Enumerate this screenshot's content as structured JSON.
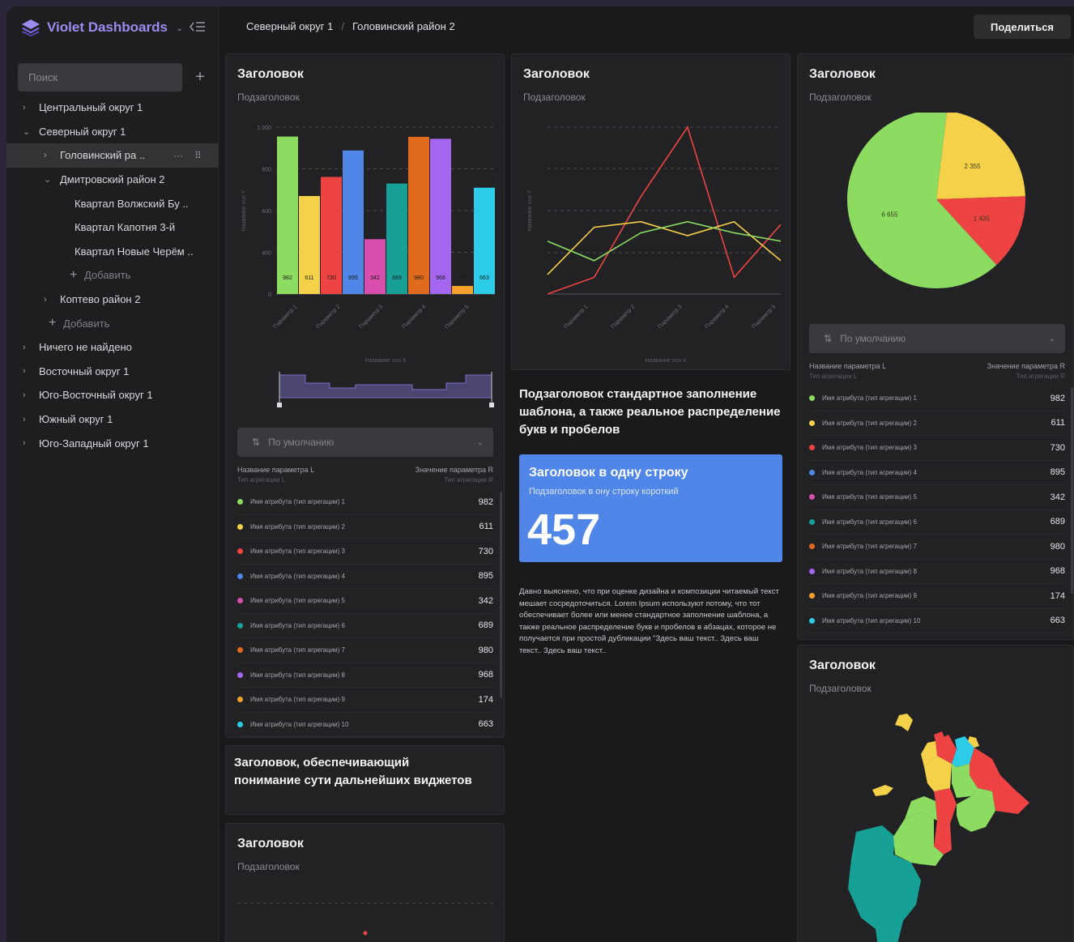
{
  "sidebar": {
    "app_name": "Violet Dashboards",
    "search_placeholder": "Поиск",
    "tree": [
      {
        "label": "Центральный округ 1",
        "level": 0,
        "arrow": "›"
      },
      {
        "label": "Северный округ 1",
        "level": 0,
        "arrow": "⌄"
      },
      {
        "label": "Головинский ра ..",
        "level": 1,
        "arrow": "›",
        "selected": true
      },
      {
        "label": "Дмитровский район 2",
        "level": 1,
        "arrow": "⌄"
      },
      {
        "label": "Квартал Волжский Бу ..",
        "level": 2,
        "arrow": ""
      },
      {
        "label": "Квартал Капотня 3-й",
        "level": 2,
        "arrow": ""
      },
      {
        "label": "Квартал Новые Черём ..",
        "level": 2,
        "arrow": ""
      },
      {
        "label": "Добавить",
        "level": 2,
        "arrow": "",
        "add": true
      },
      {
        "label": "Коптево район 2",
        "level": 1,
        "arrow": "›"
      },
      {
        "label": "Добавить",
        "level": 1,
        "arrow": "",
        "add": true
      },
      {
        "label": "Ничего не найдено",
        "level": 0,
        "arrow": "›"
      },
      {
        "label": "Восточный округ 1",
        "level": 0,
        "arrow": "›"
      },
      {
        "label": "Юго-Восточный округ 1",
        "level": 0,
        "arrow": "›"
      },
      {
        "label": "Южный округ 1",
        "level": 0,
        "arrow": "›"
      },
      {
        "label": "Юго-Западный округ 1",
        "level": 0,
        "arrow": "›"
      }
    ]
  },
  "header": {
    "breadcrumb": [
      "Северный округ 1",
      "Головинский район 2"
    ],
    "share_label": "Поделиться"
  },
  "colors": {
    "accent": "#9d8cf0",
    "kpi_bg": "#4f86e8",
    "series": [
      "#8ddc62",
      "#f5d14a",
      "#ee4343",
      "#4f86e8",
      "#d94fae",
      "#17a096",
      "#e06b1e",
      "#a466ee",
      "#f5a02c",
      "#2ccce8"
    ]
  },
  "bar_card": {
    "title": "Заголовок",
    "subtitle": "Подзаголовок",
    "select_label": "По умолчанию",
    "legend_header": {
      "left": "Название параметра L",
      "left_sub": "Тип агрегации L",
      "right": "Значение параметра R",
      "right_sub": "Тип агрегации R"
    },
    "legend": [
      {
        "name": "Имя атрибута (тип агрегации) 1",
        "value": "982"
      },
      {
        "name": "Имя атрибута (тип агрегации) 2",
        "value": "611"
      },
      {
        "name": "Имя атрибута (тип агрегации) 3",
        "value": "730"
      },
      {
        "name": "Имя атрибута (тип агрегации) 4",
        "value": "895"
      },
      {
        "name": "Имя атрибута (тип агрегации) 5",
        "value": "342"
      },
      {
        "name": "Имя атрибута (тип агрегации) 6",
        "value": "689"
      },
      {
        "name": "Имя атрибута (тип агрегации) 7",
        "value": "980"
      },
      {
        "name": "Имя атрибута (тип агрегации) 8",
        "value": "968"
      },
      {
        "name": "Имя атрибута (тип агрегации) 9",
        "value": "174"
      },
      {
        "name": "Имя атрибута (тип агрегации) 10",
        "value": "663"
      }
    ]
  },
  "line_card": {
    "title": "Заголовок",
    "subtitle": "Подзаголовок"
  },
  "pie_card": {
    "title": "Заголовок",
    "subtitle": "Подзаголовок",
    "select_label": "По умолчанию",
    "legend_header": {
      "left": "Название параметра L",
      "left_sub": "Тип агрегации L",
      "right": "Значение параметра R",
      "right_sub": "Тип агрегации R"
    },
    "legend": [
      {
        "name": "Имя атрибута (тип агрегации) 1",
        "value": "982"
      },
      {
        "name": "Имя атрибута (тип агрегации) 2",
        "value": "611"
      },
      {
        "name": "Имя атрибута (тип агрегации) 3",
        "value": "730"
      },
      {
        "name": "Имя атрибута (тип агрегации) 4",
        "value": "895"
      },
      {
        "name": "Имя атрибута (тип агрегации) 5",
        "value": "342"
      },
      {
        "name": "Имя атрибута (тип агрегации) 6",
        "value": "689"
      },
      {
        "name": "Имя атрибута (тип агрегации) 7",
        "value": "980"
      },
      {
        "name": "Имя атрибута (тип агрегации) 8",
        "value": "968"
      },
      {
        "name": "Имя атрибута (тип агрегации) 9",
        "value": "174"
      },
      {
        "name": "Имя атрибута (тип агрегации) 10",
        "value": "663"
      }
    ]
  },
  "info_block": {
    "title": "Подзаголовок стандартное заполнение шаблона, а также реальное распределение букв и пробелов",
    "paragraph": "Давно выяснено, что при оценке дизайна и композиции читаемый текст мешает сосредоточиться. Lorem Ipsum используют потому, что тот обеспечивает более или менее стандартное заполнение шаблона, а также реальное распределение букв и пробелов в абзацах, которое не получается при простой дубликации \"Здесь ваш текст.. Здесь ваш текст.. Здесь ваш текст.."
  },
  "kpi": {
    "title": "Заголовок в одну строку",
    "subtitle": "Подзаголовок в ону строку короткий",
    "value": "457"
  },
  "section_heading": "Заголовок, обеспечивающий понимание сути дальнейших виджетов",
  "bottom_card": {
    "title": "Заголовок",
    "subtitle": "Подзаголовок"
  },
  "map_card": {
    "title": "Заголовок",
    "subtitle": "Подзаголовок"
  },
  "chart_data": [
    {
      "type": "bar",
      "ylabel": "Название оси Y",
      "xlabel": "Название оси X",
      "ylim": [
        0,
        1000
      ],
      "yticks": [
        "0",
        "400",
        "600",
        "800",
        "1 000"
      ],
      "xticks": [
        "Параметр 1",
        "Параметр 2",
        "Параметр 3",
        "Параметр 4",
        "Параметр 5"
      ],
      "values": [
        982,
        611,
        730,
        895,
        342,
        689,
        980,
        968,
        174,
        663
      ]
    },
    {
      "type": "line",
      "ylabel": "Название оси Y",
      "xlabel": "Название оси X",
      "xticks": [
        "Параметр 1",
        "Параметр 2",
        "Параметр 3",
        "Параметр 4",
        "Параметр 5"
      ],
      "series": [
        {
          "color": "#ee4343",
          "values": [
            0,
            6,
            35,
            60,
            6,
            25
          ]
        },
        {
          "color": "#f5d14a",
          "values": [
            7,
            24,
            26,
            21,
            26,
            12
          ]
        },
        {
          "color": "#8ddc62",
          "values": [
            19,
            12,
            22,
            26,
            22,
            19
          ]
        }
      ]
    },
    {
      "type": "pie",
      "slices": [
        {
          "label": "6 655",
          "value": 6655,
          "color": "#8ddc62"
        },
        {
          "label": "2 355",
          "value": 2355,
          "color": "#f5d14a"
        },
        {
          "label": "1 435",
          "value": 1435,
          "color": "#ee4343"
        }
      ]
    }
  ]
}
